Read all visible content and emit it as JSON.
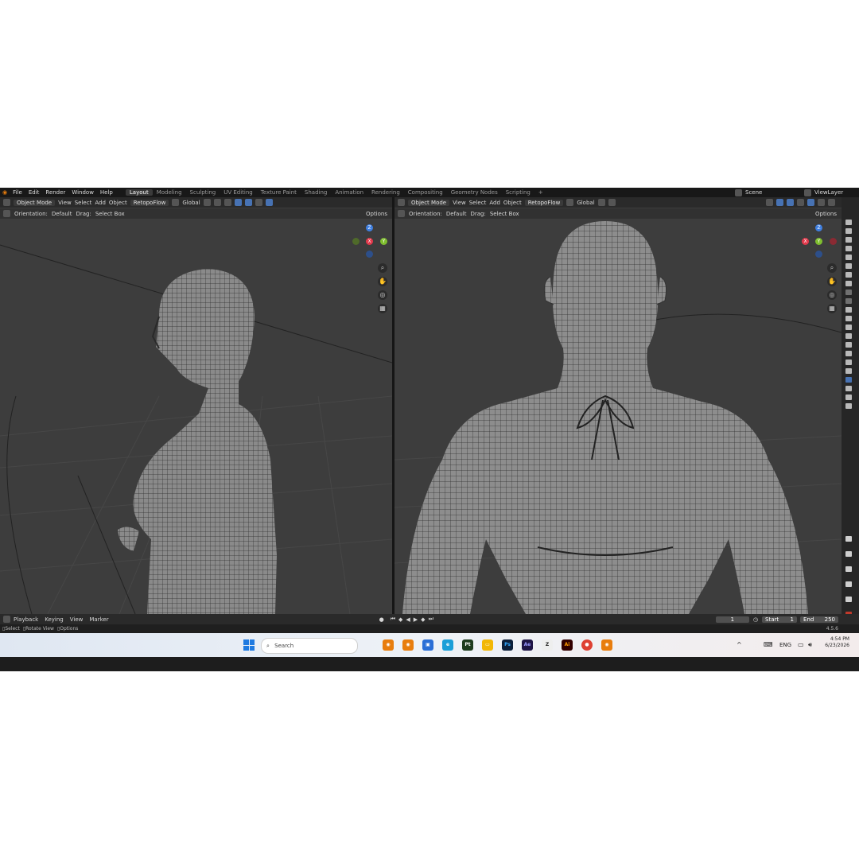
{
  "menu": {
    "items": [
      "File",
      "Edit",
      "Render",
      "Window",
      "Help"
    ]
  },
  "workspaces": [
    "Layout",
    "Modeling",
    "Sculpting",
    "UV Editing",
    "Texture Paint",
    "Shading",
    "Animation",
    "Rendering",
    "Compositing",
    "Geometry Nodes",
    "Scripting"
  ],
  "active_workspace": "Layout",
  "scene": {
    "label": "Scene",
    "view_layer": "ViewLayer"
  },
  "viewport_left": {
    "mode": "Object Mode",
    "menus": [
      "View",
      "Select",
      "Add",
      "Object"
    ],
    "addon": "RetopoFlow",
    "transform": "Global",
    "orientation_label": "Orientation:",
    "orientation_value": "Default",
    "drag_label": "Drag:",
    "drag_value": "Select Box",
    "options": "Options"
  },
  "viewport_right": {
    "mode": "Object Mode",
    "menus": [
      "View",
      "Select",
      "Add",
      "Object"
    ],
    "addon": "RetopoFlow",
    "transform": "Global",
    "orientation_label": "Orientation:",
    "orientation_value": "Default",
    "drag_label": "Drag:",
    "drag_value": "Select Box",
    "options": "Options"
  },
  "gizmo_left": {
    "z": "Z",
    "x": "X",
    "y": "Y"
  },
  "gizmo_right": {
    "z": "Z",
    "x": "X",
    "y": "Y"
  },
  "timeline": {
    "playback": "Playback",
    "keying": "Keying",
    "view": "View",
    "marker": "Marker",
    "current_frame": "1",
    "start_label": "Start",
    "start": "1",
    "end_label": "End",
    "end": "250"
  },
  "status": {
    "select": "Select",
    "rotate": "Rotate View",
    "options": "Options",
    "version": "4.5.6"
  },
  "taskbar": {
    "search": "Search",
    "lang": "ENG",
    "time": "4:54 PM",
    "date": "6/23/2026",
    "apps": [
      "Blender",
      "Blender",
      "Store",
      "Edge",
      "Pt",
      "Explorer",
      "Ps",
      "Ae",
      "ZBrush",
      "Ai",
      "Chrome",
      "Blender"
    ]
  },
  "colors": {
    "accent": "#4772b3",
    "x_axis": "#e2394b",
    "y_axis": "#7fbe2f",
    "z_axis": "#3f7fe0"
  }
}
